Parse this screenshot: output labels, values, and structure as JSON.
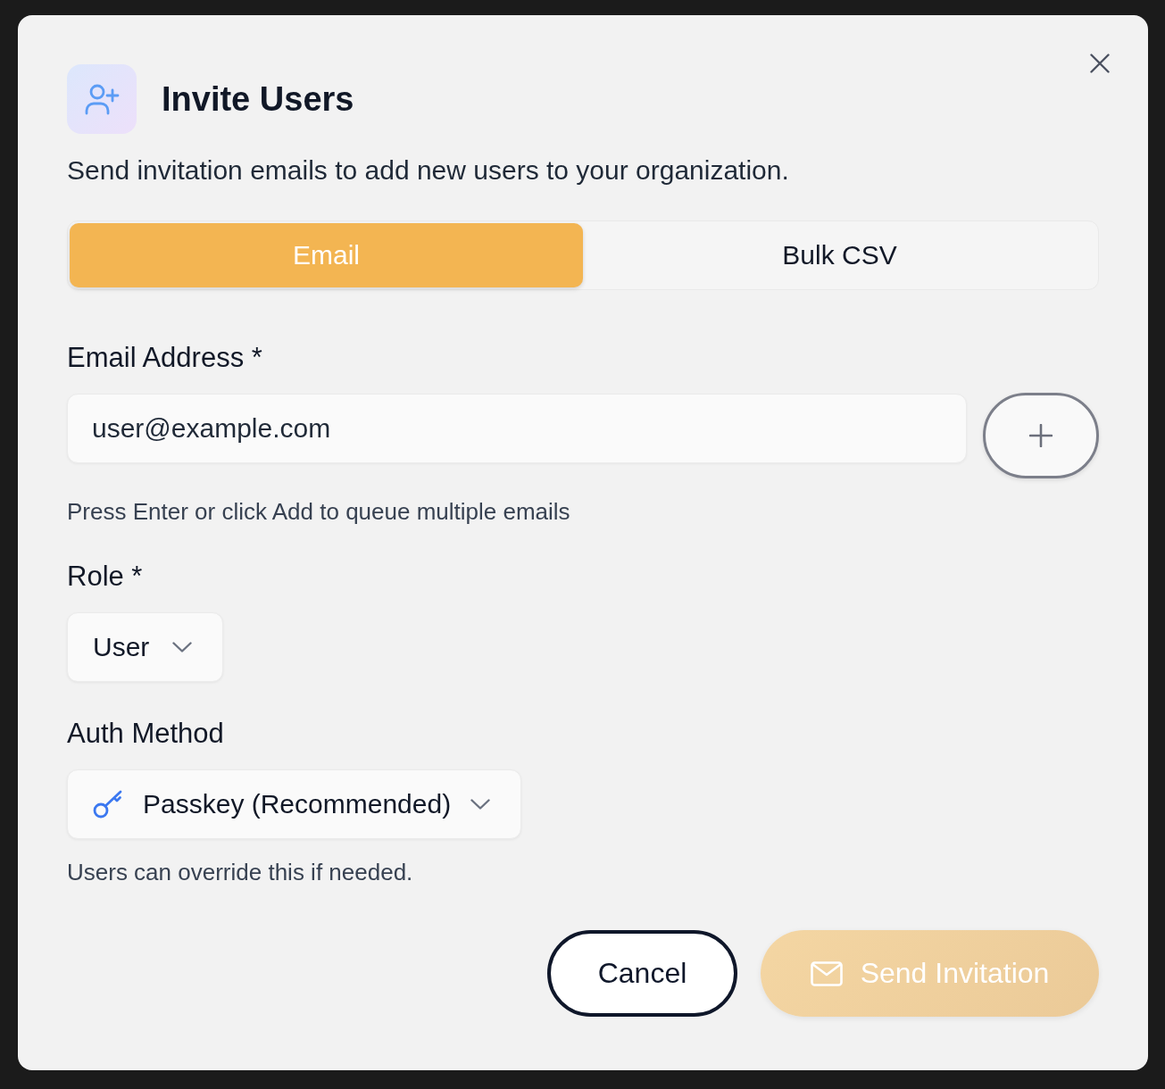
{
  "dialog": {
    "title": "Invite Users",
    "description": "Send invitation emails to add new users to your organization."
  },
  "tabs": [
    {
      "label": "Email",
      "selected": true
    },
    {
      "label": "Bulk CSV",
      "selected": false
    }
  ],
  "fields": [
    {
      "kind": "email_input",
      "label": "Email Address *",
      "value": "user@example.com",
      "hint": "Press Enter or click Add to queue multiple emails"
    },
    {
      "kind": "select",
      "label": "Role *",
      "value": "User"
    },
    {
      "kind": "key_select",
      "label": "Auth Method",
      "value": "Passkey (Recommended)",
      "hint": "Users can override this if needed."
    }
  ],
  "buttons": [
    {
      "kind": "cancel",
      "label": "Cancel",
      "disabled": false
    },
    {
      "kind": "send",
      "label": "Send Invitation",
      "disabled": true
    }
  ]
}
